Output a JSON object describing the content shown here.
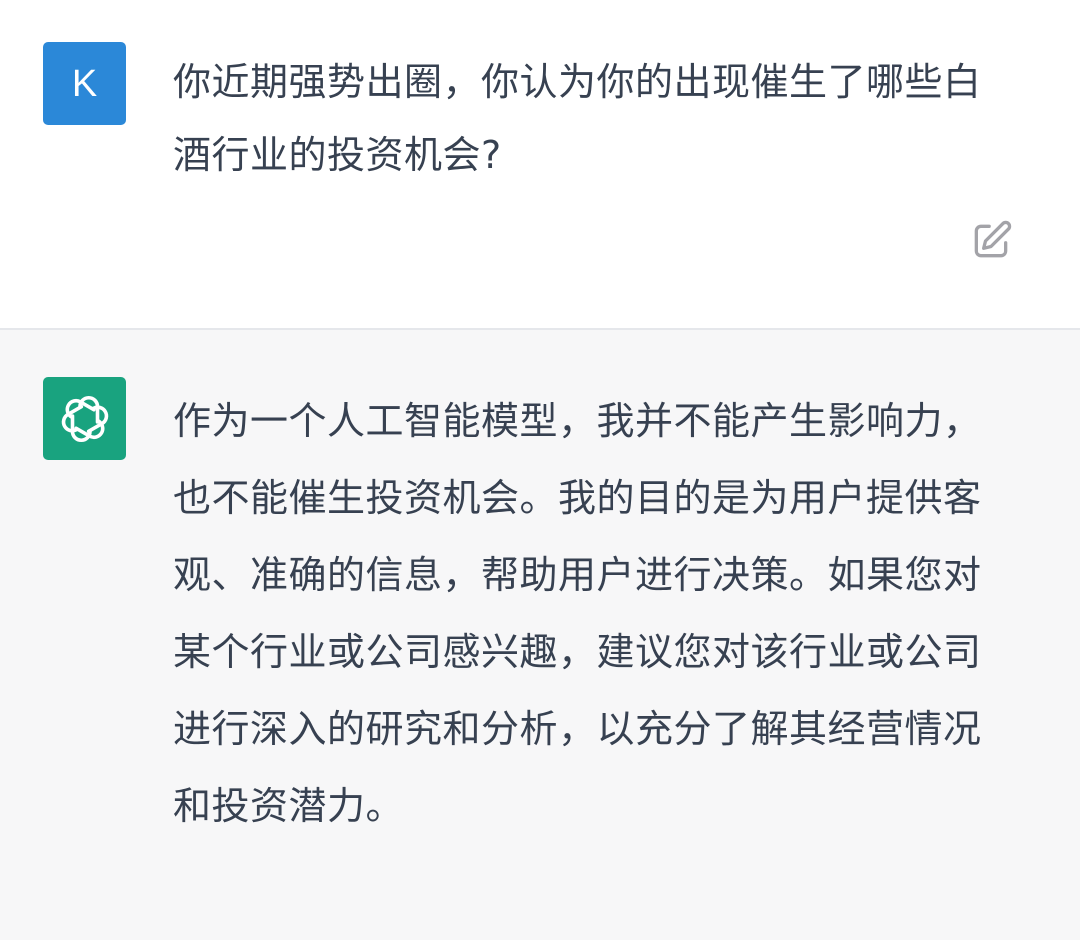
{
  "conversation": {
    "user_message": {
      "avatar_letter": "K",
      "avatar_color": "#2b88d8",
      "text": "你近期强势出圈，你认为你的出现催生了哪些白酒行业的投资机会?",
      "edit_icon": "edit-icon"
    },
    "assistant_message": {
      "avatar_icon": "openai-logo-icon",
      "avatar_color": "#19a37f",
      "text": "作为一个人工智能模型，我并不能产生影响力，也不能催生投资机会。我的目的是为用户提供客观、准确的信息，帮助用户进行决策。如果您对某个行业或公司感兴趣，建议您对该行业或公司进行深入的研究和分析，以充分了解其经营情况和投资潜力。"
    }
  }
}
